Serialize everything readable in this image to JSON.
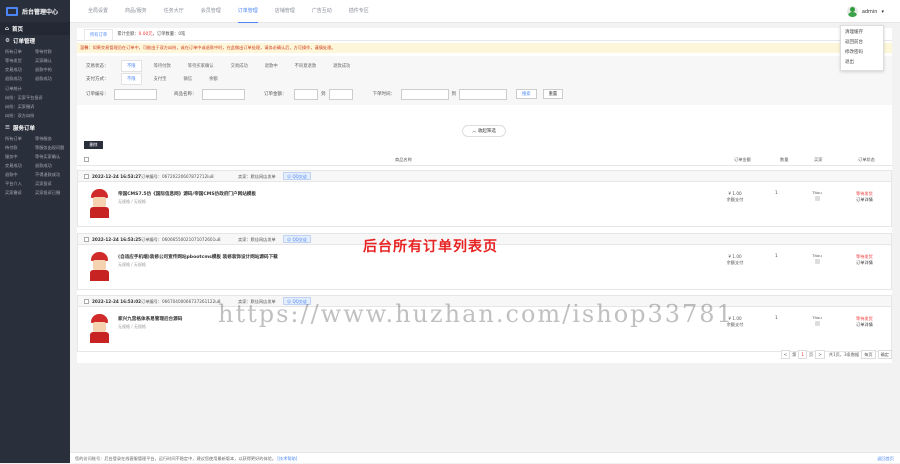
{
  "app": {
    "title": "后台管理中心"
  },
  "sidebar": {
    "home": "首页",
    "group1": "订单管理",
    "group1_items": [
      "所有订单",
      "等待付款",
      "等待发货",
      "买家确认",
      "交易成功",
      "退款中的",
      "退款成功",
      "退款成功"
    ],
    "group1_single": [
      "订单统计",
      "纠纷：买家平台投诉",
      "纠纷：买家撤诉",
      "纠纷：双方纠纷"
    ],
    "group2": "服务订单",
    "group2_items": [
      "所有订单",
      "等待服务",
      "待付款",
      "等服务出现问题",
      "服务中",
      "等待买家确认",
      "交易成功",
      "退款成功",
      "退款中",
      "不得退款成功",
      "平台介入",
      "买家投诉",
      "买家撤诉",
      "买家投诉已撤"
    ]
  },
  "topnav": [
    "全局设置",
    "商品/服务",
    "任务大厅",
    "会员管理",
    "订单管理",
    "店铺管理",
    "广告互动",
    "插件专区"
  ],
  "topnav_active": 4,
  "user": {
    "name": "admin",
    "dropdown": [
      "清理缓存",
      "返回前台",
      "修改密码",
      "退出"
    ]
  },
  "tabs": {
    "active": "所有订单",
    "info_prefix": "累计金额：",
    "info_amount": "0.00元",
    "info_suffix": "订单数量：0笔"
  },
  "warning": "温馨：如果交易管理员在订单中，可能由于双方纠纷，或在订单中或退款中时，在此做出订单处理，请务必确认后，方可操作，谨慎处理。",
  "filters": {
    "status_label": "交易状态：",
    "status_options": [
      "不限",
      "等待付款",
      "等待买家确认",
      "交易成功",
      "退款中",
      "不同意退款",
      "退款成功"
    ],
    "status_active": 0,
    "pay_label": "支付方式：",
    "pay_options": [
      "不限",
      "支付宝",
      "微信",
      "余额"
    ],
    "pay_active": 0
  },
  "search": {
    "order_no": "订单编号：",
    "goods_name": "商品名称：",
    "amount": "订单金额：",
    "to": "到",
    "time": "下单时间：",
    "search_btn": "搜索",
    "reset_btn": "重置"
  },
  "collapse": "收起筛选",
  "delete": "删除",
  "table_head": {
    "goods": "商品名称",
    "price": "订单金额",
    "qty": "数量",
    "buyer": "买家",
    "status": "订单状态"
  },
  "orders": [
    {
      "date": "2022-12-24 16:53:27",
      "sn_label": "订单编号：",
      "sn": "06720220607872712lu8",
      "seller_label": "卖家：",
      "seller": "默佳网店发单",
      "qq": "QQ交谈",
      "title": "帝国CMS7.5仿《国际信息网》源码/帝国CMS仿政府门户网站模板",
      "sub": "无规格 / 无规格",
      "price": "¥ 1.00",
      "pay": "余额支付",
      "qty": "1",
      "buyer": "Titou",
      "status1": "等待发货",
      "status2": "订单详情"
    },
    {
      "date": "2022-12-24 16:53:25",
      "sn_label": "订单编号：",
      "sn": "06066550021071072601u8",
      "seller_label": "卖家：",
      "seller": "默佳网店发单",
      "qq": "QQ交谈",
      "title": "(自适应手机端)装修公司宣传网站pbootcms模板 装修装饰设计网站源码下载",
      "sub": "无规格 / 无规格",
      "price": "¥ 1.00",
      "pay": "余额支付",
      "qty": "1",
      "buyer": "Titou",
      "status1": "等待发货",
      "status2": "订单详情"
    },
    {
      "date": "2022-12-24 16:53:02",
      "sn_label": "订单编号：",
      "sn": "06670400066737261122u8",
      "seller_label": "卖家：",
      "seller": "默佳网店发单",
      "qq": "QQ交谈",
      "title": "家兴九宫格体系易管理后台源码",
      "sub": "无规格 / 无规格",
      "price": "¥ 1.00",
      "pay": "余额支付",
      "qty": "1",
      "buyer": "Titou",
      "status1": "等待发货",
      "status2": "订单详情"
    }
  ],
  "pager": {
    "prev": "<",
    "first_label": "第",
    "page": "1",
    "page_label": "页",
    "next": ">",
    "total": "共1页，3条数据",
    "per_page": "每页",
    "go": "确定"
  },
  "banner": "后台所有订单列表页",
  "watermark": "https://www.huzhan.com/ishop33781",
  "footer": {
    "text": "您的访问账号：后台登录在线客服管理平台，运行时间不稳定中，建议您使用最新版本，以获得更好的体验。",
    "link": "[技术帮助]",
    "help": "返回首页"
  }
}
